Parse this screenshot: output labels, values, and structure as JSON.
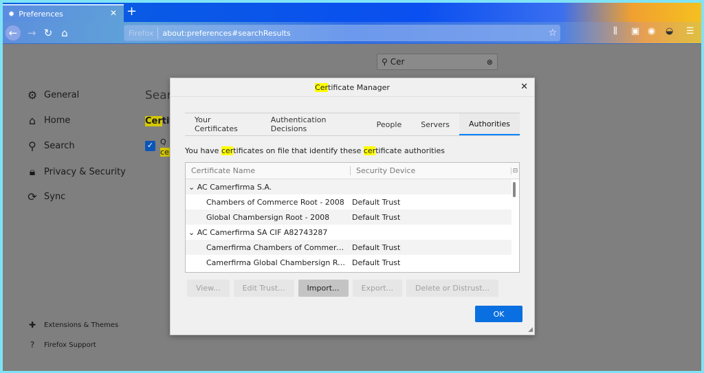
{
  "browser": {
    "tab_title": "Preferences",
    "url_identity": "Firefox",
    "url": "about:preferences#searchResults"
  },
  "sidebar": {
    "items": [
      {
        "icon": "gear-icon",
        "label": "General"
      },
      {
        "icon": "home-icon",
        "label": "Home"
      },
      {
        "icon": "search-icon",
        "label": "Search"
      },
      {
        "icon": "lock-icon",
        "label": "Privacy & Security"
      },
      {
        "icon": "sync-icon",
        "label": "Sync"
      }
    ],
    "footer": [
      {
        "icon": "puzzle-icon",
        "label": "Extensions & Themes"
      },
      {
        "icon": "help-icon",
        "label": "Firefox Support"
      }
    ]
  },
  "search": {
    "value": "Cer"
  },
  "page": {
    "heading": "Sear",
    "result_hl": "Cer",
    "result_rest": "tif",
    "checkbox_label": "Q",
    "checkbox_hl": "cer"
  },
  "dialog": {
    "title_hl": "Cer",
    "title_rest": "tificate Manager",
    "tabs": [
      "Your Certificates",
      "Authentication Decisions",
      "People",
      "Servers",
      "Authorities"
    ],
    "active_tab": "Authorities",
    "desc": {
      "a": "You have ",
      "b": "cer",
      "c": "tificates on file that identify these ",
      "d": "cer",
      "e": "tificate authorities"
    },
    "columns": [
      "Certificate Name",
      "Security Device"
    ],
    "rows": [
      {
        "name": "AC Camerfirma S.A.",
        "device": "",
        "group": true
      },
      {
        "name": "Chambers of Commerce Root - 2008",
        "device": "Default Trust"
      },
      {
        "name": "Global Chambersign Root - 2008",
        "device": "Default Trust"
      },
      {
        "name": "AC Camerfirma SA CIF A82743287",
        "device": "",
        "group": true
      },
      {
        "name": "Camerfirma Chambers of Commerce Root",
        "device": "Default Trust"
      },
      {
        "name": "Camerfirma Global Chambersign Root",
        "device": "Default Trust"
      }
    ],
    "buttons": [
      "View...",
      "Edit Trust...",
      "Import...",
      "Export...",
      "Delete or Distrust..."
    ],
    "ok": "OK"
  },
  "colors": {
    "accent": "#0a84ff",
    "highlight": "#ffff00"
  }
}
